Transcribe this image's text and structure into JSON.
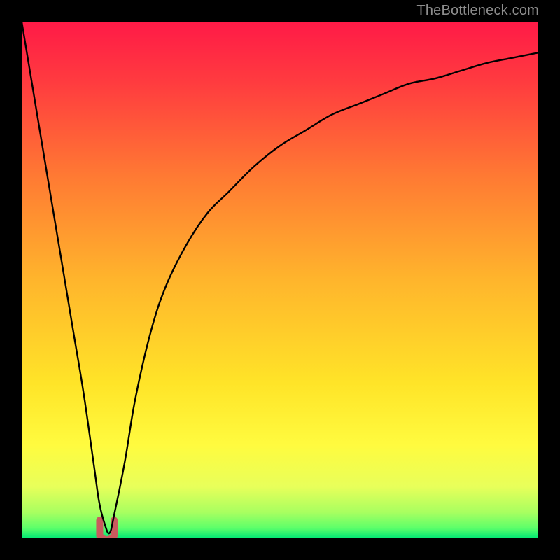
{
  "watermark": "TheBottleneck.com",
  "colors": {
    "black": "#000000",
    "gradient_stops": [
      {
        "offset": 0.0,
        "color": "#ff1a47"
      },
      {
        "offset": 0.12,
        "color": "#ff3c3f"
      },
      {
        "offset": 0.3,
        "color": "#ff7a33"
      },
      {
        "offset": 0.5,
        "color": "#ffb52c"
      },
      {
        "offset": 0.7,
        "color": "#ffe428"
      },
      {
        "offset": 0.82,
        "color": "#fffb3f"
      },
      {
        "offset": 0.9,
        "color": "#e8ff5a"
      },
      {
        "offset": 0.95,
        "color": "#a8ff60"
      },
      {
        "offset": 0.98,
        "color": "#5dff6a"
      },
      {
        "offset": 1.0,
        "color": "#00e874"
      }
    ],
    "marker": "#c95a5e",
    "curve": "#000000"
  },
  "chart_data": {
    "type": "line",
    "title": "",
    "xlabel": "",
    "ylabel": "",
    "xlim": [
      0,
      100
    ],
    "ylim": [
      0,
      100
    ],
    "series": [
      {
        "name": "bottleneck-curve",
        "x": [
          0,
          2,
          5,
          8,
          10,
          12,
          14,
          15,
          16,
          17,
          18,
          20,
          22,
          25,
          28,
          32,
          36,
          40,
          45,
          50,
          55,
          60,
          65,
          70,
          75,
          80,
          85,
          90,
          95,
          100
        ],
        "values": [
          100,
          88,
          70,
          52,
          40,
          28,
          14,
          7,
          3,
          1,
          5,
          15,
          27,
          40,
          49,
          57,
          63,
          67,
          72,
          76,
          79,
          82,
          84,
          86,
          88,
          89,
          90.5,
          92,
          93,
          94
        ]
      }
    ],
    "marker_region": {
      "name": "optimal-marker",
      "x_center": 16.5,
      "x_half_width": 1.4,
      "y_min": 0.5,
      "y_max": 3.5
    }
  }
}
